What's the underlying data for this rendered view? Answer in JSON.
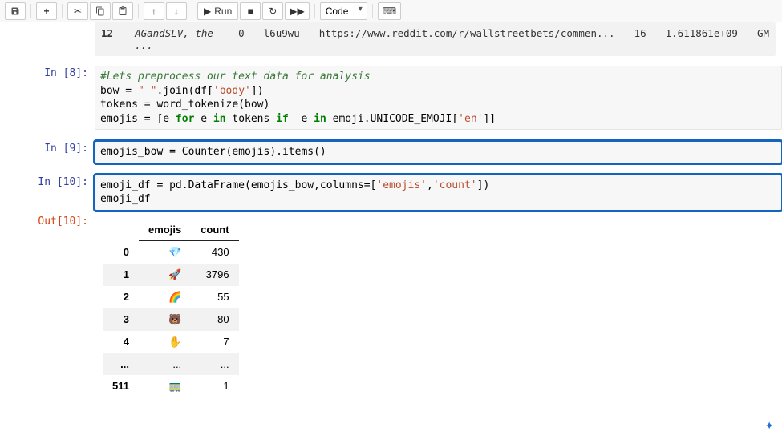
{
  "toolbar": {
    "run_label": "Run",
    "celltype": "Code"
  },
  "partial_output": {
    "index": "12",
    "body_line2": "AGandSLV, the ...",
    "score": "0",
    "id": "l6u9wu",
    "url": "https://www.reddit.com/r/wallstreetbets/commen...",
    "col5": "16",
    "col6": "1.611861e+09",
    "col7": "GM"
  },
  "cells": {
    "c8": {
      "prompt": "In [8]:",
      "line1_comment": "#Lets preprocess our text data for analysis",
      "line2_a": "bow = ",
      "line2_str": "\" \"",
      "line2_b": ".join(df[",
      "line2_str2": "'body'",
      "line2_c": "])",
      "line3": "tokens = word_tokenize(bow)",
      "line4_a": "emojis = [e ",
      "line4_for": "for",
      "line4_b": " e ",
      "line4_in": "in",
      "line4_c": " tokens ",
      "line4_if": "if",
      "line4_d": "  e ",
      "line4_in2": "in",
      "line4_e": " emoji.UNICODE_EMOJI[",
      "line4_str": "'en'",
      "line4_f": "]]"
    },
    "c9": {
      "prompt": "In [9]:",
      "code": "emojis_bow = Counter(emojis).items()"
    },
    "c10": {
      "prompt": "In [10]:",
      "line1_a": "emoji_df = pd.DataFrame(emojis_bow,columns=[",
      "line1_s1": "'emojis'",
      "line1_b": ",",
      "line1_s2": "'count'",
      "line1_c": "])",
      "line2": "emoji_df"
    },
    "out10": {
      "prompt": "Out[10]:"
    }
  },
  "dataframe": {
    "columns": [
      "emojis",
      "count"
    ],
    "rows": [
      {
        "idx": "0",
        "emoji": "💎",
        "count": "430"
      },
      {
        "idx": "1",
        "emoji": "🚀",
        "count": "3796"
      },
      {
        "idx": "2",
        "emoji": "🌈",
        "count": "55"
      },
      {
        "idx": "3",
        "emoji": "🐻",
        "count": "80"
      },
      {
        "idx": "4",
        "emoji": "✋",
        "count": "7"
      },
      {
        "idx": "...",
        "emoji": "...",
        "count": "..."
      },
      {
        "idx": "511",
        "emoji": "🚃",
        "count": "1"
      }
    ]
  }
}
